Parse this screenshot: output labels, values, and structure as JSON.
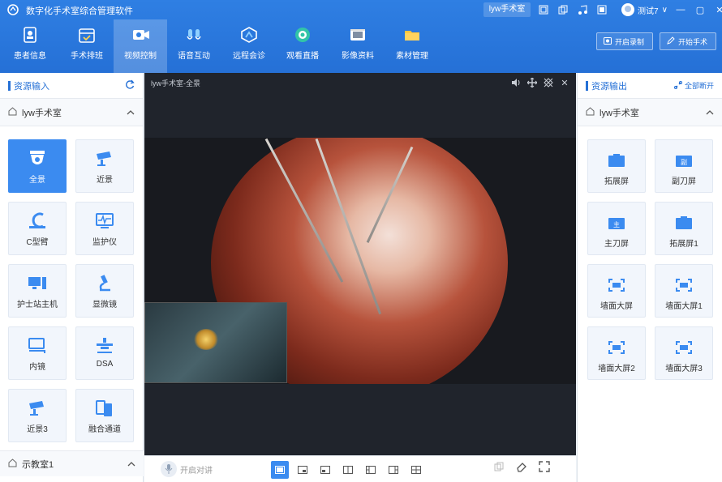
{
  "app": {
    "title": "数字化手术室综合管理软件",
    "room_chip": "lyw手术室",
    "user": "测试7",
    "user_caret": "∨"
  },
  "colors": {
    "accent": "#2570d6",
    "active_card": "#3b8bf0",
    "video_bg": "#20242c"
  },
  "nav": [
    {
      "label": "患者信息",
      "icon": "patient-icon"
    },
    {
      "label": "手术排班",
      "icon": "calendar-icon"
    },
    {
      "label": "视频控制",
      "icon": "camera-icon",
      "active": true
    },
    {
      "label": "语音互动",
      "icon": "voice-icon"
    },
    {
      "label": "远程会诊",
      "icon": "remote-icon"
    },
    {
      "label": "观看直播",
      "icon": "live-icon"
    },
    {
      "label": "影像资料",
      "icon": "film-icon"
    },
    {
      "label": "素材管理",
      "icon": "folder-icon"
    }
  ],
  "nav_right": {
    "record": "开启录制",
    "start_surgery": "开始手术"
  },
  "left": {
    "title": "资源输入",
    "room": "lyw手术室",
    "sources": [
      {
        "label": "全景",
        "icon": "dome-camera-icon",
        "active": true
      },
      {
        "label": "近景",
        "icon": "cctv-camera-icon"
      },
      {
        "label": "C型臂",
        "icon": "c-arm-icon"
      },
      {
        "label": "监护仪",
        "icon": "monitor-icon"
      },
      {
        "label": "护士站主机",
        "icon": "workstation-icon"
      },
      {
        "label": "显微镜",
        "icon": "microscope-icon"
      },
      {
        "label": "内镜",
        "icon": "endoscope-icon"
      },
      {
        "label": "DSA",
        "icon": "dsa-icon"
      },
      {
        "label": "近景3",
        "icon": "cctv-camera-icon"
      },
      {
        "label": "融合通道",
        "icon": "fusion-icon"
      }
    ],
    "bottom_room": "示教室1"
  },
  "center": {
    "video_title": "lyw手术室-全景",
    "talk": "开启对讲"
  },
  "right": {
    "title": "资源输出",
    "disconnect_all": "全部断开",
    "room": "lyw手术室",
    "outputs": [
      {
        "label": "拓展屏",
        "icon": "screen-icon"
      },
      {
        "label": "副刀屏",
        "icon": "sub-screen-icon"
      },
      {
        "label": "主刀屏",
        "icon": "main-screen-icon"
      },
      {
        "label": "拓展屏1",
        "icon": "screen-icon"
      },
      {
        "label": "墙面大屏",
        "icon": "wall-screen-icon"
      },
      {
        "label": "墙面大屏1",
        "icon": "wall-screen-icon"
      },
      {
        "label": "墙面大屏2",
        "icon": "wall-screen-icon"
      },
      {
        "label": "墙面大屏3",
        "icon": "wall-screen-icon"
      }
    ]
  }
}
